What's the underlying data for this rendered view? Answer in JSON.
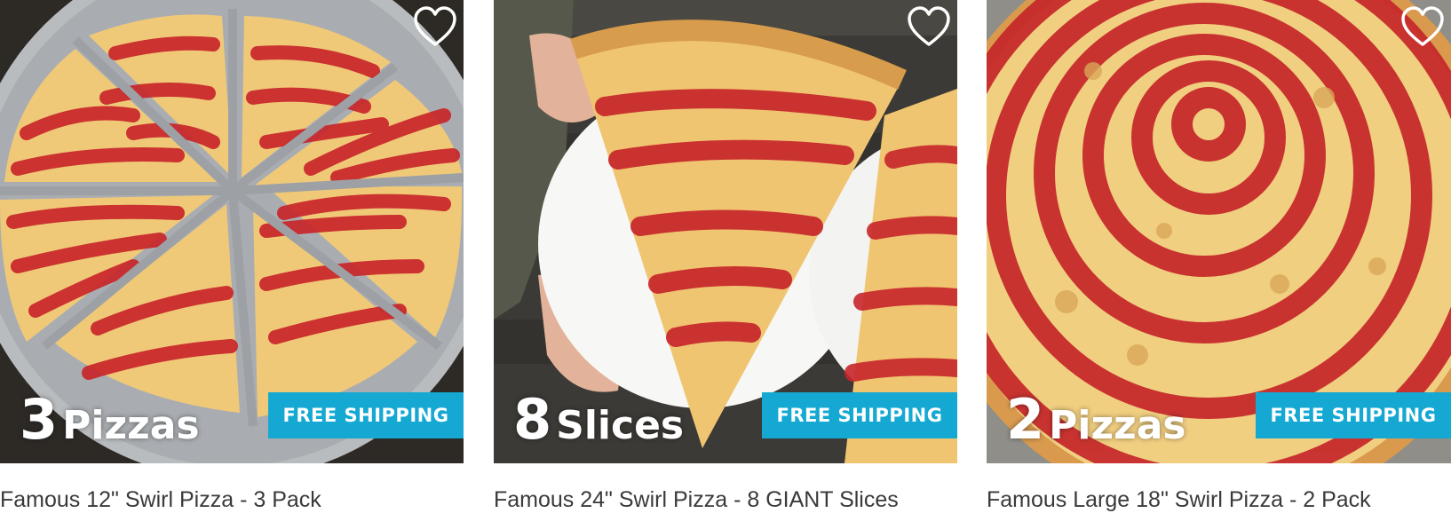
{
  "products": [
    {
      "count": "3",
      "unit": "Pizzas",
      "badge": "FREE SHIPPING",
      "title": "Famous 12\" Swirl Pizza - 3 Pack",
      "image": "pizza-tray-sliced"
    },
    {
      "count": "8",
      "unit": "Slices",
      "badge": "FREE SHIPPING",
      "title": "Famous 24\" Swirl Pizza - 8 GIANT Slices",
      "image": "giant-slice-on-plate"
    },
    {
      "count": "2",
      "unit": "Pizzas",
      "badge": "FREE SHIPPING",
      "title": "Famous Large 18\" Swirl Pizza - 2 Pack",
      "image": "whole-swirl-pizza"
    }
  ],
  "colors": {
    "badge": "#14a8d2",
    "title_text": "#3a3a3a",
    "sauce": "#c8262a",
    "cheese": "#f2cf86"
  },
  "icons": {
    "favorite": "heart-outline-icon"
  }
}
